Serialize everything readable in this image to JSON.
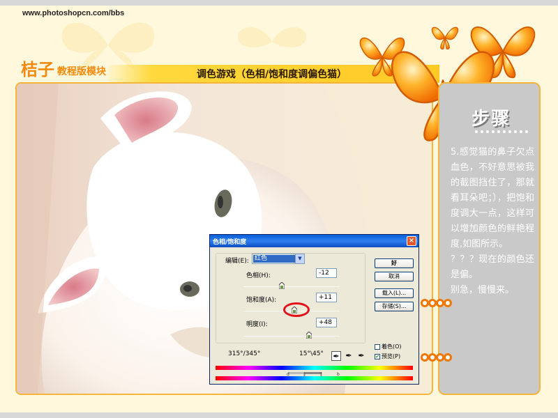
{
  "header": {
    "site_url": "www.photoshopcn.com/bbs",
    "brand_main": "桔子",
    "brand_sub": "教程版模块",
    "title": "调色游戏（色相/饱和度调偏色猫）"
  },
  "steps": {
    "heading": "步骤",
    "paragraphs": [
      "5.感觉猫的鼻子欠点血色，不好意思被我的截图挡住了，那就看耳朵吧；），把饱和度调大一点，这样可以增加颜色的鲜艳程度,如图所示。",
      "？？？现在的颜色还是偏。",
      "别急，慢慢来。"
    ]
  },
  "dialog": {
    "title": "色相/饱和度",
    "close_label": "×",
    "edit_label": "编辑(E):",
    "edit_value": "红色",
    "hue_label": "色相(H):",
    "hue_value": "-12",
    "saturation_label": "饱和度(A):",
    "saturation_value": "+11",
    "lightness_label": "明度(I):",
    "lightness_value": "+48",
    "ok_label": "好",
    "cancel_label": "取消",
    "load_label": "载入(L)...",
    "save_label": "存储(S)...",
    "colorize_label": "着色(O)",
    "colorize_checked": false,
    "preview_label": "预览(P)",
    "preview_checked": true,
    "range_left": "315°/345°",
    "range_right": "15°\\45°",
    "slider_positions": {
      "hue": 0.4,
      "saturation": 0.53,
      "lightness": 0.68
    }
  },
  "colors": {
    "accent_orange": "#f58a0a",
    "panel_gray": "#c9c9c9",
    "frame_gold": "#f5b43a",
    "highlight_red": "#e3121a"
  }
}
